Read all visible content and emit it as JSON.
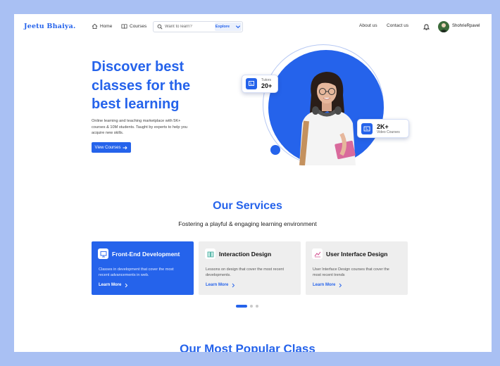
{
  "nav": {
    "logo": "Jeetu Bhaiya.",
    "home_label": "Home",
    "courses_label": "Courses",
    "search_placeholder": "Want to learn?",
    "explore_label": "Explore",
    "about_label": "About us",
    "contact_label": "Contact us",
    "username": "ShohrieRpavel"
  },
  "hero": {
    "title": "Discover best classes for the best learning",
    "description": "Online learning and teaching marketplace with 5K+ courses & 10M students. Taught by experts to help you acquire new skills.",
    "cta_label": "View Courses",
    "tutors_label": "Tutors",
    "tutors_count": "20+",
    "videos_count": "2K+",
    "videos_label": "Video Courses"
  },
  "services": {
    "title": "Our Services",
    "subtitle": "Fostering a playful & engaging learning environment",
    "cards": [
      {
        "title": "Front-End Development",
        "desc": "Classes in development that cover the most recent advancements in web.",
        "link": "Learn More",
        "icon": "monitor-icon"
      },
      {
        "title": "Interaction Design",
        "desc": "Lessons on design that cover the most recent developments.",
        "link": "Learn More",
        "icon": "book-icon"
      },
      {
        "title": "User Interface Design",
        "desc": "User Interface Design courses that cover the most recent  trends",
        "link": "Learn More",
        "icon": "chart-icon"
      }
    ]
  },
  "popular": {
    "title": "Our Most Popular Class"
  },
  "colors": {
    "accent": "#2563eb",
    "frame": "#a9c0f3"
  }
}
